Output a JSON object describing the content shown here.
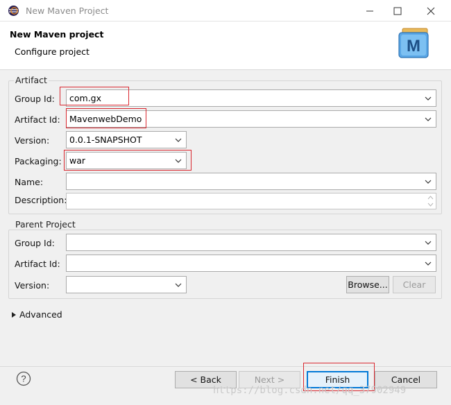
{
  "window": {
    "title": "New Maven Project"
  },
  "header": {
    "title": "New Maven project",
    "subtitle": "Configure project"
  },
  "artifact": {
    "group_label": "Artifact",
    "group_id_label": "Group Id:",
    "group_id_value": "com.gx",
    "artifact_id_label": "Artifact Id:",
    "artifact_id_value": "MavenwebDemo",
    "version_label": "Version:",
    "version_value": "0.0.1-SNAPSHOT",
    "packaging_label": "Packaging:",
    "packaging_value": "war",
    "name_label": "Name:",
    "name_value": "",
    "description_label": "Description:",
    "description_value": ""
  },
  "parent": {
    "group_label": "Parent Project",
    "group_id_label": "Group Id:",
    "group_id_value": "",
    "artifact_id_label": "Artifact Id:",
    "artifact_id_value": "",
    "version_label": "Version:",
    "version_value": "",
    "browse_label": "Browse...",
    "clear_label": "Clear"
  },
  "advanced": {
    "label": "Advanced"
  },
  "footer": {
    "help_icon": "?",
    "back_label": "< Back",
    "next_label": "Next >",
    "finish_label": "Finish",
    "cancel_label": "Cancel"
  },
  "watermark": "https://blog.csdn.net/qq_37902949",
  "colors": {
    "highlight": "#d9262e",
    "default_button": "#0078d7",
    "maven_icon": "#3f8fd2"
  },
  "icons": [
    "eclipse-icon",
    "minimize-icon",
    "maximize-icon",
    "close-icon",
    "maven-logo-icon",
    "chevron-down-icon",
    "expand-triangle-icon",
    "help-icon"
  ]
}
